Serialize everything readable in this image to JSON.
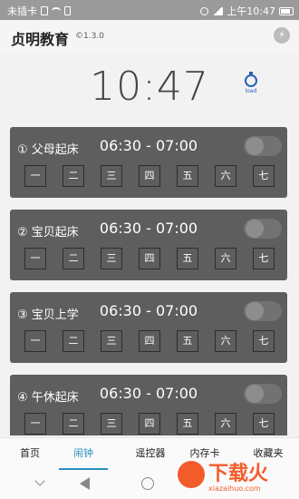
{
  "status_bar": {
    "carrier": "未插卡",
    "time": "上午10:47"
  },
  "header": {
    "title": "贞明教育",
    "version": "©1.3.0"
  },
  "clock": {
    "time": "10:47",
    "load_label": "load"
  },
  "alarms": [
    {
      "name": "① 父母起床",
      "time": "06:30 - 07:00",
      "enabled": false
    },
    {
      "name": "② 宝贝起床",
      "time": "06:30 - 07:00",
      "enabled": false
    },
    {
      "name": "③ 宝贝上学",
      "time": "06:30 - 07:00",
      "enabled": false
    },
    {
      "name": "④ 午休起床",
      "time": "06:30 - 07:00",
      "enabled": false
    }
  ],
  "days": [
    "一",
    "二",
    "三",
    "四",
    "五",
    "六",
    "七"
  ],
  "tabs": [
    {
      "label": "首页",
      "active": false
    },
    {
      "label": "闹钟",
      "active": true
    },
    {
      "label": "遥控器",
      "active": false
    },
    {
      "label": "内存卡",
      "active": false
    },
    {
      "label": "收藏夹",
      "active": false
    }
  ],
  "watermark": {
    "text": "下载火",
    "url": "xiazaihuo.com"
  },
  "colors": {
    "accent": "#2b8fc0",
    "card": "#5e5e5e",
    "watermark": "#f25c2a"
  }
}
